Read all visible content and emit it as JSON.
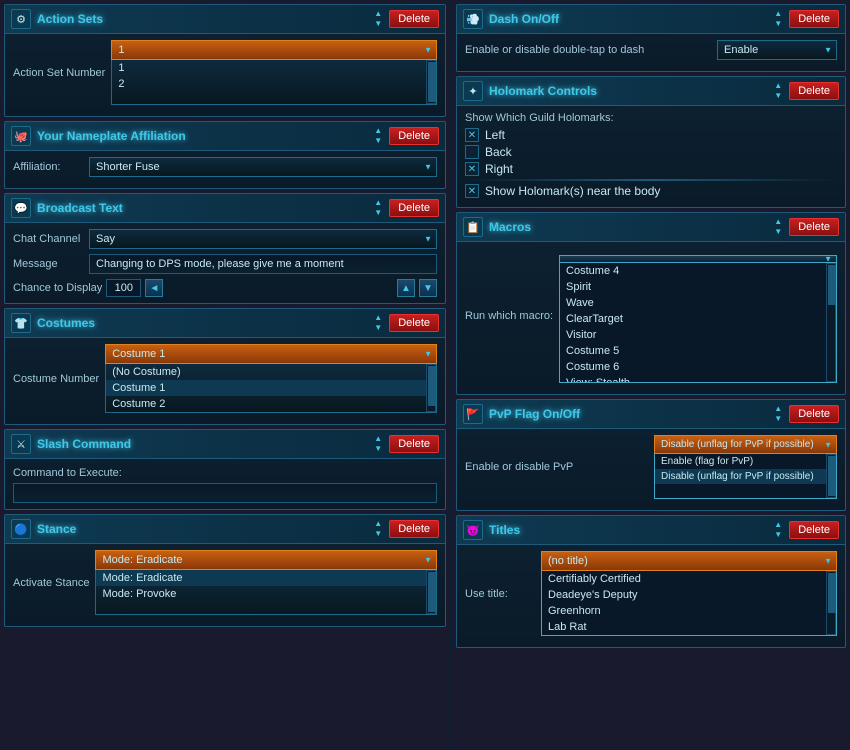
{
  "left": {
    "actionSets": {
      "title": "Action Sets",
      "deleteLabel": "Delete",
      "actionSetLabel": "Action Set Number",
      "selectedValue": "1",
      "options": [
        "1",
        "2"
      ]
    },
    "nameplateAffiliation": {
      "title": "Your Nameplate Affiliation",
      "deleteLabel": "Delete",
      "affiliationLabel": "Affiliation:",
      "selectedValue": "Shorter Fuse"
    },
    "broadcastText": {
      "title": "Broadcast Text",
      "deleteLabel": "Delete",
      "chatChannelLabel": "Chat Channel",
      "chatChannelValue": "Say",
      "messageLabel": "Message",
      "messageValue": "Changing to DPS mode, please give me a moment",
      "chanceLabel": "Chance to Display",
      "chanceValue": "100"
    },
    "costumes": {
      "title": "Costumes",
      "deleteLabel": "Delete",
      "costumeNumberLabel": "Costume Number",
      "selectedValue": "Costume 1",
      "options": [
        "(No Costume)",
        "Costume 1",
        "Costume 2"
      ]
    },
    "slashCommand": {
      "title": "Slash Command",
      "deleteLabel": "Delete",
      "commandLabel": "Command to Execute:",
      "commandValue": ""
    },
    "stance": {
      "title": "Stance",
      "deleteLabel": "Delete",
      "activateLabel": "Activate Stance",
      "selectedValue": "Mode: Eradicate",
      "options": [
        "Mode: Eradicate",
        "Mode: Provoke"
      ]
    }
  },
  "right": {
    "dashOnOff": {
      "title": "Dash On/Off",
      "deleteLabel": "Delete",
      "description": "Enable or disable double-tap to dash",
      "dropdownValue": "Enable"
    },
    "holomarkControls": {
      "title": "Holomark Controls",
      "deleteLabel": "Delete",
      "showLabel": "Show Which Guild Holomarks:",
      "checkboxes": [
        {
          "label": "Left",
          "checked": true
        },
        {
          "label": "Back",
          "checked": false
        },
        {
          "label": "Right",
          "checked": true
        }
      ],
      "nearBodyLabel": "Show Holomark(s) near the body",
      "nearBodyChecked": true
    },
    "macros": {
      "title": "Macros",
      "deleteLabel": "Delete",
      "runLabel": "Run which macro:",
      "dropdownItems": [
        "Costume 4",
        "Spirit",
        "Wave",
        "ClearTarget",
        "Visitor",
        "Costume 5",
        "Costume 6",
        "View: Stealth"
      ]
    },
    "pvpFlagOnOff": {
      "title": "PvP Flag On/Off",
      "deleteLabel": "Delete",
      "description": "Enable or disable PvP",
      "selectedValue": "Disable (unflag for PvP if possible)",
      "options": [
        "Enable (flag for PvP)",
        "Disable (unflag for PvP if possible)"
      ]
    },
    "titles": {
      "title": "Titles",
      "deleteLabel": "Delete",
      "useLabel": "Use title:",
      "selectedValue": "(no title)",
      "options": [
        "Certifiably Certified",
        "Deadeye's Deputy",
        "Greenhorn",
        "Lab Rat"
      ]
    }
  },
  "icons": {
    "actionSets": "⚙",
    "nameplate": "🐙",
    "broadcastText": "💬",
    "costumes": "👕",
    "slashCommand": "⚔",
    "stance": "🔵",
    "dash": "💨",
    "holomark": "✦",
    "macros": "📋",
    "pvp": "🚩",
    "titles": "😈"
  }
}
